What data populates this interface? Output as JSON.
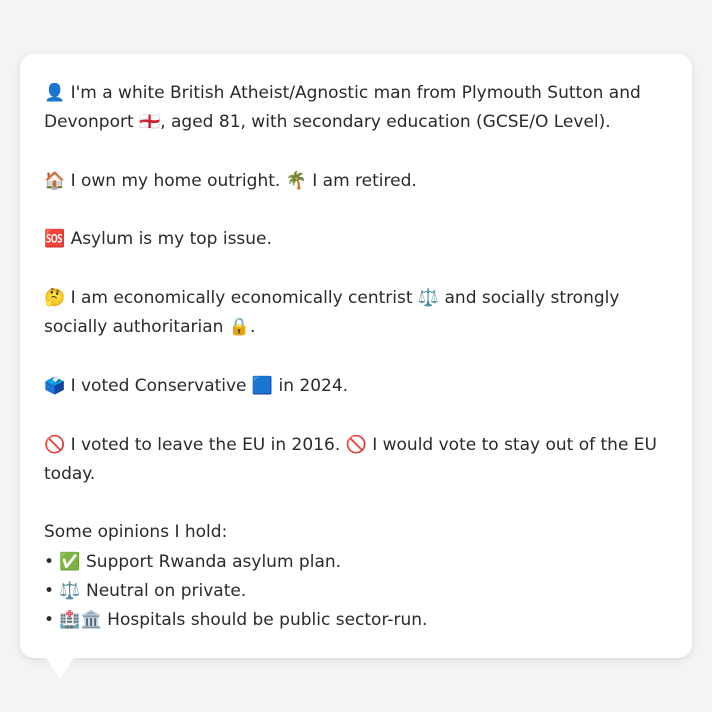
{
  "profile": {
    "intro": "👤 I'm a white British Atheist/Agnostic man from Plymouth Sutton and Devonport 🏴󠁧󠁢󠁥󠁮󠁧󠁿, aged 81, with secondary education (GCSE/O Level).",
    "housing": "🏠 I own my home outright. 🌴 I am retired.",
    "top_issue": "🆘 Asylum is my top issue.",
    "ideology": "🤔 I am economically economically centrist ⚖️ and socially strongly socially authoritarian 🔒.",
    "vote_2024": "🗳️ I voted Conservative 🟦 in 2024.",
    "eu": "🚫 I voted to leave the EU in 2016. 🚫 I would vote to stay out of the EU today.",
    "opinions_heading": "Some opinions I hold:",
    "opinions": [
      "• ✅ Support Rwanda asylum plan.",
      "• ⚖️ Neutral on private.",
      "• 🏥🏛️ Hospitals should be public sector-run."
    ]
  }
}
